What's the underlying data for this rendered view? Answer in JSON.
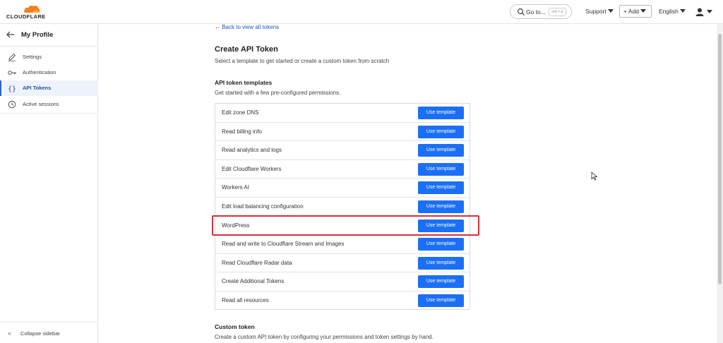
{
  "header": {
    "brand": "CLOUDFLARE",
    "goto_label": "Go to...",
    "goto_shortcut": "ctrl + k",
    "support_label": "Support",
    "add_label": "Add",
    "language_label": "English"
  },
  "sidebar": {
    "title": "My Profile",
    "items": [
      {
        "label": "Settings",
        "icon": "pencil-icon"
      },
      {
        "label": "Authentication",
        "icon": "key-icon"
      },
      {
        "label": "API Tokens",
        "icon": "braces-icon",
        "active": true
      },
      {
        "label": "Active sessions",
        "icon": "clock-icon"
      }
    ],
    "collapse_label": "Collapse sidebar"
  },
  "main": {
    "back_link": "← Back to view all tokens",
    "title": "Create API Token",
    "subtitle": "Select a template to get started or create a custom token from scratch",
    "templates_heading": "API token templates",
    "templates_subtitle": "Get started with a few pre-configured permissions.",
    "template_button_label": "Use template",
    "templates": [
      "Edit zone DNS",
      "Read billing info",
      "Read analytics and logs",
      "Edit Cloudflare Workers",
      "Workers AI",
      "Edit load balancing configuration",
      "WordPress",
      "Read and write to Cloudflare Stream and Images",
      "Read Cloudflare Radar data",
      "Create Additional Tokens",
      "Read all resources"
    ],
    "highlighted_template": "WordPress",
    "custom_heading": "Custom token",
    "custom_subtitle": "Create a custom API token by configuring your permissions and token settings by hand."
  },
  "colors": {
    "accent": "#1b6ff5",
    "highlight": "#d62f3b",
    "link": "#2557b8",
    "brand_orange": "#f38020"
  }
}
